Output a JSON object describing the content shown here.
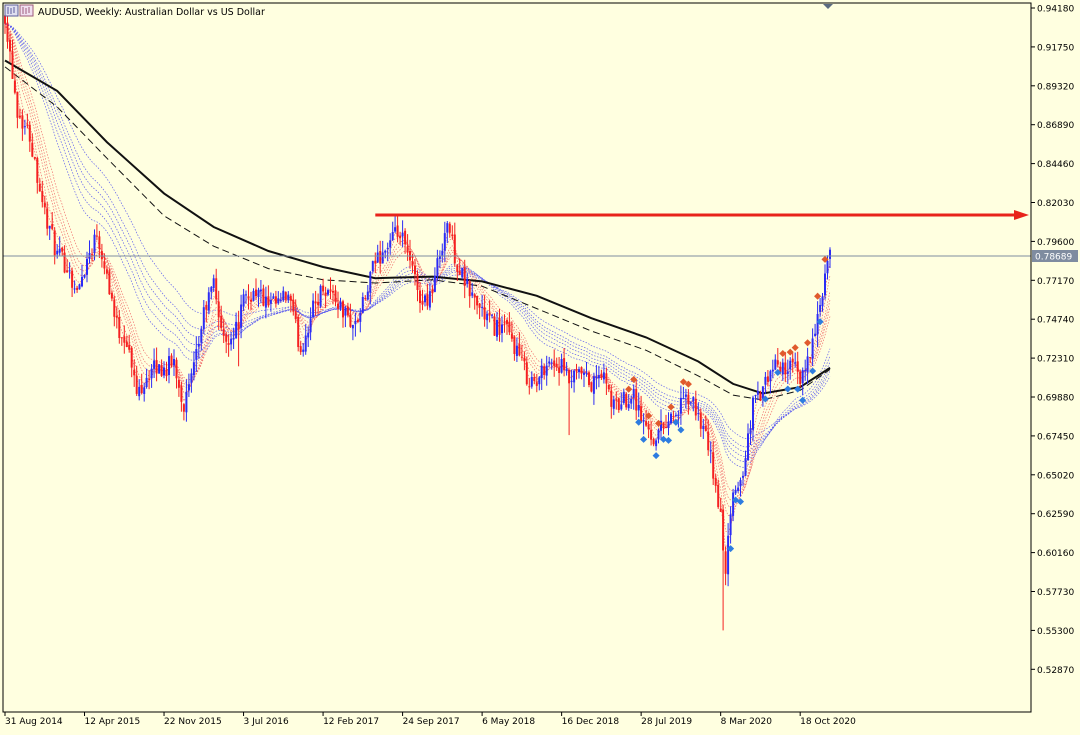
{
  "header": {
    "title": "AUDUSD, Weekly:  Australian Dollar vs US Dollar",
    "icon": "chart-window-icon"
  },
  "colors": {
    "background": "#ffffe0",
    "frame": "#000000",
    "bull_candle": "#2b2bf5",
    "bear_candle": "#f52020",
    "ma_long": "#111111",
    "ma_dashed": "#111111",
    "ribbon_red": "#f06060",
    "ribbon_blue": "#4f4ff0",
    "arrow": "#e8231b",
    "price_line": "#7f8ca0",
    "price_label_bg": "#7f8ca0",
    "signal_blue": "#2d7ce0",
    "signal_red": "#e05a2d"
  },
  "chart_data": {
    "type": "candlestick",
    "symbol": "AUDUSD",
    "timeframe": "Weekly",
    "y_ticks": [
      "0.94180",
      "0.91750",
      "0.89320",
      "0.86890",
      "0.84460",
      "0.82030",
      "0.79600",
      "0.77170",
      "0.74740",
      "0.72310",
      "0.69880",
      "0.67450",
      "0.65020",
      "0.62590",
      "0.60160",
      "0.57730",
      "0.55300",
      "0.52870"
    ],
    "ylim": [
      0.5127,
      0.9418
    ],
    "x_labels": [
      "31 Aug 2014",
      "12 Apr 2015",
      "22 Nov 2015",
      "3 Jul 2016",
      "12 Feb 2017",
      "24 Sep 2017",
      "6 May 2018",
      "16 Dec 2018",
      "28 Jul 2019",
      "8 Mar 2020",
      "18 Oct 2020"
    ],
    "x_label_dates": [
      "2014-08-31",
      "2015-04-12",
      "2015-11-22",
      "2016-07-03",
      "2017-02-12",
      "2017-09-24",
      "2018-05-06",
      "2018-12-16",
      "2019-07-28",
      "2020-03-08",
      "2020-10-18"
    ],
    "xlim": [
      "2014-08-31",
      "2021-01-10"
    ],
    "current_price": "0.78689",
    "resistance_level": 0.8125,
    "resistance_start": "2017-07-09",
    "price_path": [
      [
        "2014-08-31",
        0.938
      ],
      [
        "2014-10-05",
        0.878
      ],
      [
        "2014-11-09",
        0.862
      ],
      [
        "2014-12-21",
        0.814
      ],
      [
        "2015-01-25",
        0.787
      ],
      [
        "2015-02-22",
        0.781
      ],
      [
        "2015-03-22",
        0.763
      ],
      [
        "2015-04-12",
        0.78
      ],
      [
        "2015-05-17",
        0.802
      ],
      [
        "2015-06-14",
        0.776
      ],
      [
        "2015-07-12",
        0.743
      ],
      [
        "2015-08-09",
        0.734
      ],
      [
        "2015-09-06",
        0.701
      ],
      [
        "2015-10-04",
        0.712
      ],
      [
        "2015-11-01",
        0.717
      ],
      [
        "2015-11-22",
        0.716
      ],
      [
        "2015-12-20",
        0.721
      ],
      [
        "2016-01-17",
        0.693
      ],
      [
        "2016-02-14",
        0.715
      ],
      [
        "2016-03-13",
        0.751
      ],
      [
        "2016-04-10",
        0.77
      ],
      [
        "2016-05-08",
        0.733
      ],
      [
        "2016-06-12",
        0.741
      ],
      [
        "2016-07-03",
        0.758
      ],
      [
        "2016-08-07",
        0.766
      ],
      [
        "2016-09-11",
        0.755
      ],
      [
        "2016-10-09",
        0.757
      ],
      [
        "2016-11-06",
        0.762
      ],
      [
        "2016-12-11",
        0.728
      ],
      [
        "2017-01-15",
        0.754
      ],
      [
        "2017-02-12",
        0.768
      ],
      [
        "2017-03-12",
        0.763
      ],
      [
        "2017-04-09",
        0.752
      ],
      [
        "2017-05-14",
        0.743
      ],
      [
        "2017-06-11",
        0.76
      ],
      [
        "2017-07-09",
        0.784
      ],
      [
        "2017-08-13",
        0.793
      ],
      [
        "2017-09-10",
        0.801
      ],
      [
        "2017-09-24",
        0.796
      ],
      [
        "2017-10-22",
        0.777
      ],
      [
        "2017-11-19",
        0.757
      ],
      [
        "2017-12-17",
        0.766
      ],
      [
        "2018-01-14",
        0.796
      ],
      [
        "2018-01-28",
        0.808
      ],
      [
        "2018-02-25",
        0.781
      ],
      [
        "2018-03-25",
        0.767
      ],
      [
        "2018-04-22",
        0.757
      ],
      [
        "2018-05-06",
        0.752
      ],
      [
        "2018-06-10",
        0.743
      ],
      [
        "2018-07-08",
        0.742
      ],
      [
        "2018-08-12",
        0.728
      ],
      [
        "2018-09-09",
        0.712
      ],
      [
        "2018-10-07",
        0.706
      ],
      [
        "2018-11-04",
        0.722
      ],
      [
        "2018-12-16",
        0.717
      ],
      [
        "2019-01-06",
        0.708
      ],
      [
        "2019-02-10",
        0.713
      ],
      [
        "2019-03-10",
        0.705
      ],
      [
        "2019-04-07",
        0.714
      ],
      [
        "2019-05-12",
        0.692
      ],
      [
        "2019-06-09",
        0.697
      ],
      [
        "2019-07-07",
        0.702
      ],
      [
        "2019-07-28",
        0.685
      ],
      [
        "2019-09-01",
        0.673
      ],
      [
        "2019-10-06",
        0.684
      ],
      [
        "2019-11-03",
        0.689
      ],
      [
        "2019-12-08",
        0.698
      ],
      [
        "2020-01-05",
        0.688
      ],
      [
        "2020-02-09",
        0.661
      ],
      [
        "2020-03-08",
        0.622
      ],
      [
        "2020-03-22",
        0.592
      ],
      [
        "2020-04-12",
        0.637
      ],
      [
        "2020-05-10",
        0.651
      ],
      [
        "2020-06-07",
        0.695
      ],
      [
        "2020-07-05",
        0.702
      ],
      [
        "2020-08-02",
        0.717
      ],
      [
        "2020-09-06",
        0.718
      ],
      [
        "2020-10-04",
        0.716
      ],
      [
        "2020-10-18",
        0.706
      ],
      [
        "2020-11-15",
        0.729
      ],
      [
        "2020-12-06",
        0.745
      ],
      [
        "2020-12-20",
        0.765
      ],
      [
        "2021-01-03",
        0.78
      ],
      [
        "2021-01-10",
        0.787
      ]
    ],
    "ma_long": [
      [
        "2014-08-31",
        0.909
      ],
      [
        "2015-01-25",
        0.89
      ],
      [
        "2015-06-14",
        0.858
      ],
      [
        "2015-11-22",
        0.826
      ],
      [
        "2016-04-10",
        0.805
      ],
      [
        "2016-09-11",
        0.79
      ],
      [
        "2017-02-12",
        0.78
      ],
      [
        "2017-07-09",
        0.773
      ],
      [
        "2017-12-17",
        0.774
      ],
      [
        "2018-05-06",
        0.771
      ],
      [
        "2018-10-07",
        0.762
      ],
      [
        "2019-03-10",
        0.748
      ],
      [
        "2019-08-11",
        0.736
      ],
      [
        "2020-01-05",
        0.721
      ],
      [
        "2020-04-12",
        0.707
      ],
      [
        "2020-07-05",
        0.701
      ],
      [
        "2020-10-18",
        0.705
      ],
      [
        "2021-01-10",
        0.717
      ]
    ],
    "ma_dashed": [
      [
        "2014-08-31",
        0.905
      ],
      [
        "2015-01-25",
        0.88
      ],
      [
        "2015-06-14",
        0.848
      ],
      [
        "2015-11-22",
        0.812
      ],
      [
        "2016-04-10",
        0.793
      ],
      [
        "2016-09-11",
        0.779
      ],
      [
        "2017-02-12",
        0.772
      ],
      [
        "2017-07-09",
        0.77
      ],
      [
        "2017-12-17",
        0.772
      ],
      [
        "2018-05-06",
        0.768
      ],
      [
        "2018-10-07",
        0.754
      ],
      [
        "2019-03-10",
        0.74
      ],
      [
        "2019-08-11",
        0.728
      ],
      [
        "2020-01-05",
        0.712
      ],
      [
        "2020-04-12",
        0.7
      ],
      [
        "2020-07-05",
        0.697
      ],
      [
        "2020-10-18",
        0.703
      ],
      [
        "2021-01-10",
        0.716
      ]
    ],
    "signal_weeks_blue": [
      "2019-07-21",
      "2019-08-04",
      "2019-09-08",
      "2019-09-29",
      "2019-10-13",
      "2019-11-03",
      "2019-11-17",
      "2020-04-05",
      "2020-04-19",
      "2020-05-03",
      "2020-07-12",
      "2020-08-16",
      "2020-09-13",
      "2020-10-11",
      "2020-10-25",
      "2020-11-22",
      "2020-12-13"
    ],
    "signal_weeks_red": [
      "2019-06-23",
      "2019-07-07",
      "2019-08-18",
      "2019-09-15",
      "2019-10-20",
      "2019-11-24",
      "2019-12-08",
      "2020-08-30",
      "2020-09-20",
      "2020-10-04",
      "2020-11-08",
      "2020-12-06",
      "2020-12-27"
    ]
  }
}
